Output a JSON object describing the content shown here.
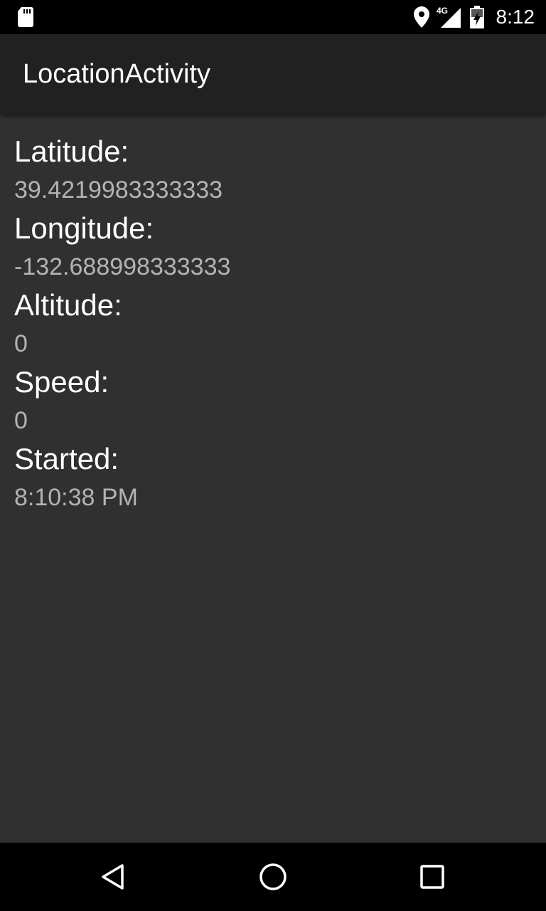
{
  "status_bar": {
    "time": "8:12",
    "network": "4G",
    "icons": [
      "sd-card-icon",
      "location-pin-icon",
      "cell-signal-icon",
      "battery-charging-icon"
    ]
  },
  "app_bar": {
    "title": "LocationActivity"
  },
  "location": {
    "latitude_label": "Latitude:",
    "latitude_value": "39.4219983333333",
    "longitude_label": "Longitude:",
    "longitude_value": "-132.688998333333",
    "altitude_label": "Altitude:",
    "altitude_value": "0",
    "speed_label": "Speed:",
    "speed_value": "0",
    "started_label": "Started:",
    "started_value": "8:10:38 PM"
  },
  "nav_bar": {
    "buttons": [
      "back-icon",
      "home-icon",
      "recents-icon"
    ]
  },
  "colors": {
    "status_bar": "#000000",
    "app_bar": "#212121",
    "background": "#303030",
    "label_text": "#ffffff",
    "value_text": "#b3b3b3"
  }
}
